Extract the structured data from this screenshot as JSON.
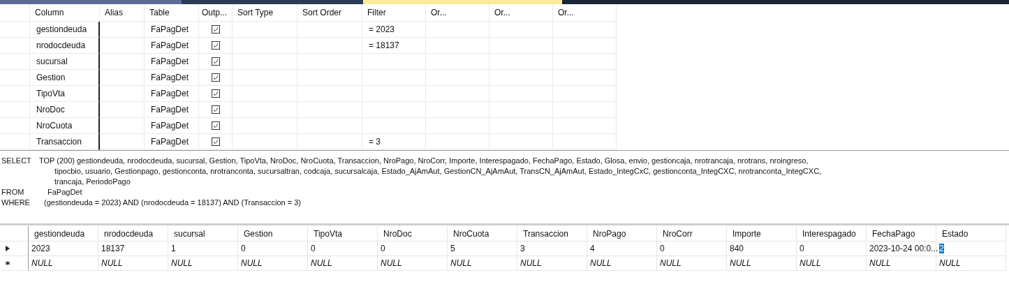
{
  "document_tabs": [
    {
      "selected": false,
      "color": "#5b6b94"
    },
    {
      "selected": false,
      "color": "#2b3a55"
    },
    {
      "selected": true,
      "color": "#fdeb9a"
    }
  ],
  "criteria_grid": {
    "columns": [
      "Column",
      "Alias",
      "Table",
      "Outp...",
      "Sort Type",
      "Sort Order",
      "Filter",
      "Or...",
      "Or...",
      "Or..."
    ],
    "rows": [
      {
        "column": "gestiondeuda",
        "table": "FaPagDet",
        "output": true,
        "filter": "= 2023"
      },
      {
        "column": "nrodocdeuda",
        "table": "FaPagDet",
        "output": true,
        "filter": "= 18137"
      },
      {
        "column": "sucursal",
        "table": "FaPagDet",
        "output": true
      },
      {
        "column": "Gestion",
        "table": "FaPagDet",
        "output": true
      },
      {
        "column": "TipoVta",
        "table": "FaPagDet",
        "output": true
      },
      {
        "column": "NroDoc",
        "table": "FaPagDet",
        "output": true
      },
      {
        "column": "NroCuota",
        "table": "FaPagDet",
        "output": true
      },
      {
        "column": "Transaccion",
        "table": "FaPagDet",
        "output": true,
        "filter": "= 3"
      }
    ]
  },
  "sql_pane": {
    "clauses": [
      {
        "keyword": "SELECT",
        "lines": [
          "TOP (200) gestiondeuda, nrodocdeuda, sucursal, Gestion, TipoVta, NroDoc, NroCuota, Transaccion, NroPago, NroCorr, Importe, Interespagado, FechaPago, Estado, Glosa, envio, gestioncaja, nrotrancaja, nrotrans, nroingreso,",
          "tipocbio, usuario, Gestionpago, gestionconta, nrotranconta, sucursaltran, codcaja, sucursalcaja, Estado_AjAmAut, GestionCN_AjAmAut, TransCN_AjAmAut, Estado_IntegCxC, gestionconta_IntegCXC, nrotranconta_IntegCXC,",
          "trancaja, PeriodoPago"
        ]
      },
      {
        "keyword": "FROM",
        "lines": [
          "FaPagDet"
        ]
      },
      {
        "keyword": "WHERE",
        "lines": [
          "(gestiondeuda = 2023) AND (nrodocdeuda = 18137) AND (Transaccion = 3)"
        ]
      }
    ]
  },
  "results_grid": {
    "columns": [
      "gestiondeuda",
      "nrodocdeuda",
      "sucursal",
      "Gestion",
      "TipoVta",
      "NroDoc",
      "NroCuota",
      "Transaccion",
      "NroPago",
      "NroCorr",
      "Importe",
      "Interespagado",
      "FechaPago",
      "Estado"
    ],
    "rows": [
      {
        "kind": "current",
        "cells": [
          {
            "text": "2023",
            "selected": false
          },
          {
            "text": "18137",
            "selected": false
          },
          {
            "text": "1",
            "selected": false
          },
          {
            "text": "0",
            "selected": false
          },
          {
            "text": "0",
            "selected": false
          },
          {
            "text": "0",
            "selected": false
          },
          {
            "text": "5",
            "selected": false
          },
          {
            "text": "3",
            "selected": false
          },
          {
            "text": "4",
            "selected": false
          },
          {
            "text": "0",
            "selected": false
          },
          {
            "text": "840",
            "selected": false
          },
          {
            "text": "0",
            "selected": false
          },
          {
            "text": "2023-10-24 00:0...",
            "selected": false
          },
          {
            "text": "2",
            "selected": true
          }
        ]
      },
      {
        "kind": "new",
        "cells": [
          {
            "text": "NULL",
            "selected": false
          },
          {
            "text": "NULL",
            "selected": false
          },
          {
            "text": "NULL",
            "selected": false
          },
          {
            "text": "NULL",
            "selected": false
          },
          {
            "text": "NULL",
            "selected": false
          },
          {
            "text": "NULL",
            "selected": false
          },
          {
            "text": "NULL",
            "selected": false
          },
          {
            "text": "NULL",
            "selected": false
          },
          {
            "text": "NULL",
            "selected": false
          },
          {
            "text": "NULL",
            "selected": false
          },
          {
            "text": "NULL",
            "selected": false
          },
          {
            "text": "NULL",
            "selected": false
          },
          {
            "text": "NULL",
            "selected": false
          },
          {
            "text": "NULL",
            "selected": false
          }
        ]
      }
    ]
  }
}
